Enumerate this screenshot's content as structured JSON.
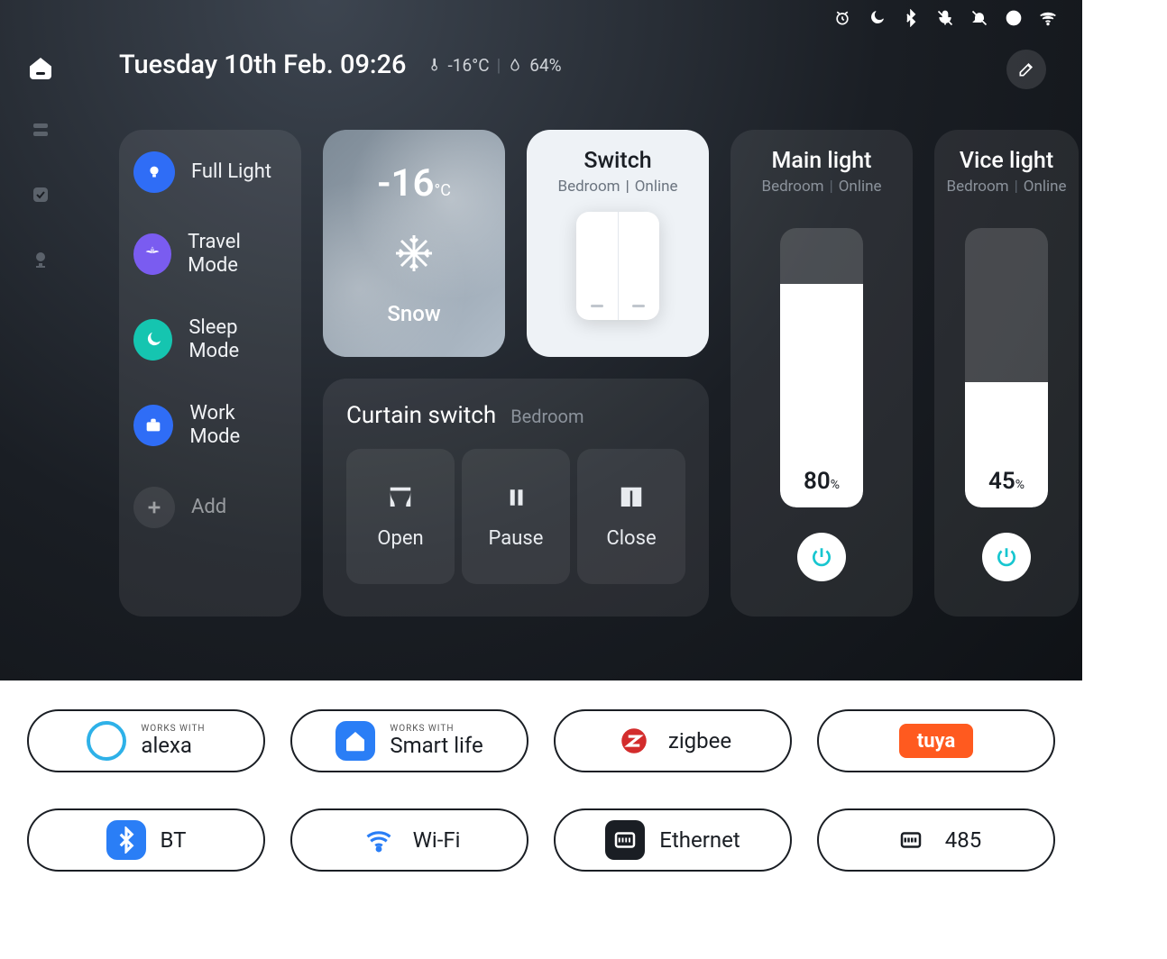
{
  "status_icons": [
    "alarm-icon",
    "moon-icon",
    "bluetooth-icon",
    "mic-muted-icon",
    "bell-muted-icon",
    "globe-icon",
    "wifi-icon"
  ],
  "header": {
    "datetime": "Tuesday 10th Feb. 09:26",
    "temperature": "-16°C",
    "humidity": "64%"
  },
  "scenes": [
    {
      "label": "Full Light",
      "icon": "bulb",
      "color": "blue"
    },
    {
      "label": "Travel Mode",
      "icon": "palm",
      "color": "purple"
    },
    {
      "label": "Sleep Mode",
      "icon": "moon",
      "color": "teal"
    },
    {
      "label": "Work Mode",
      "icon": "briefcase",
      "color": "blue"
    },
    {
      "label": "Add",
      "icon": "plus",
      "color": "grey"
    }
  ],
  "weather": {
    "temp": "-16",
    "unit": "°C",
    "condition": "Snow"
  },
  "switch": {
    "title": "Switch",
    "room": "Bedroom",
    "status": "Online"
  },
  "curtain": {
    "title": "Curtain switch",
    "room": "Bedroom",
    "buttons": [
      {
        "label": "Open",
        "icon": "open"
      },
      {
        "label": "Pause",
        "icon": "pause"
      },
      {
        "label": "Close",
        "icon": "close"
      }
    ]
  },
  "lights": [
    {
      "title": "Main light",
      "room": "Bedroom",
      "status": "Online",
      "level": 80
    },
    {
      "title": "Vice light",
      "room": "Bedroom",
      "status": "Online",
      "level": 45
    }
  ],
  "badges_row1": [
    {
      "sub": "WORKS WITH",
      "label": "alexa",
      "icon": "alexa"
    },
    {
      "sub": "WORKS WITH",
      "label": "Smart life",
      "icon": "smartlife"
    },
    {
      "sub": "",
      "label": "zigbee",
      "icon": "zigbee"
    },
    {
      "sub": "",
      "label": "tuya",
      "icon": "tuya"
    }
  ],
  "badges_row2": [
    {
      "label": "BT",
      "icon": "bt"
    },
    {
      "label": "Wi-Fi",
      "icon": "wifi"
    },
    {
      "label": "Ethernet",
      "icon": "ethernet"
    },
    {
      "label": "485",
      "icon": "485"
    }
  ]
}
